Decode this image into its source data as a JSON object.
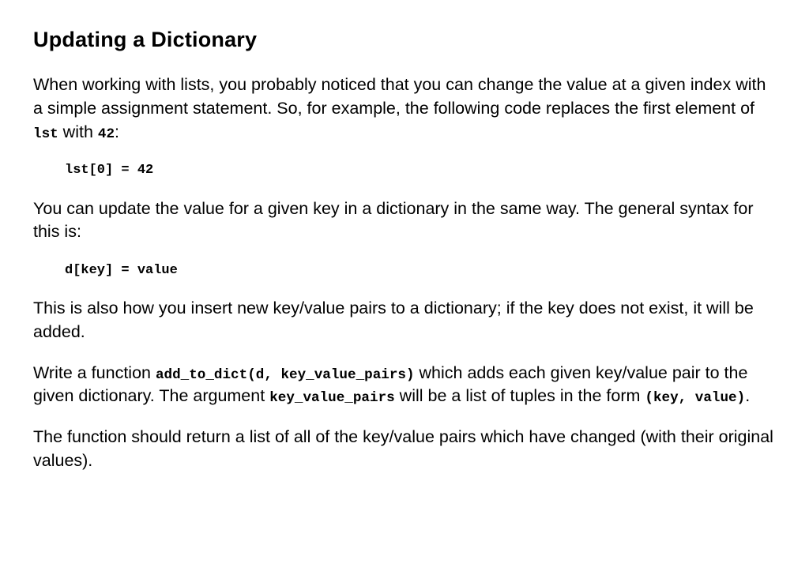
{
  "heading": "Updating a Dictionary",
  "p1a": "When working with lists, you probably noticed that you can change the value at a given index with a simple assignment statement. So, for example, the following code replaces the first element of ",
  "p1_code1": "lst",
  "p1b": " with ",
  "p1_code2": "42",
  "p1c": ":",
  "code_block1": "lst[0] = 42",
  "p2": "You can update the value for a given key in a dictionary in the same way. The general syntax for this is:",
  "code_block2": "d[key] = value",
  "p3": "This is also how you insert new key/value pairs to a dictionary; if the key does not exist, it will be added.",
  "p4a": "Write a function ",
  "p4_code1": "add_to_dict(d, key_value_pairs)",
  "p4b": " which adds each given key/value pair to the given dictionary. The argument ",
  "p4_code2": "key_value_pairs",
  "p4c": " will be a list of tuples in the form ",
  "p4_code3": "(key, value)",
  "p4d": ".",
  "p5": "The function should return a list of all of the key/value pairs which have changed (with their original values)."
}
